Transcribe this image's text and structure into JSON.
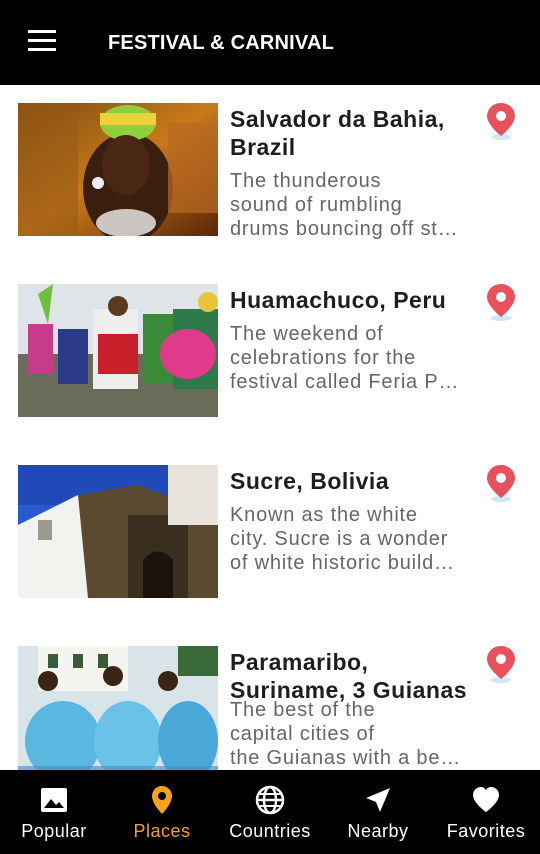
{
  "app": {
    "title": "FESTIVAL & CARNIVAL"
  },
  "colors": {
    "accent": "#f7a21b",
    "pin": "#e8505b",
    "bar": "#000000"
  },
  "places": [
    {
      "name": "Salvador da Bahia, Brazil",
      "desc": [
        "The thunderous",
        "sound of rumbling",
        "drums bouncing off st…"
      ],
      "icon": "map-pin-icon"
    },
    {
      "name": "Huamachuco, Peru",
      "desc": [
        "The weekend of",
        "celebrations for the",
        "festival called Feria P…"
      ],
      "icon": "map-pin-icon"
    },
    {
      "name": "Sucre, Bolivia",
      "desc": [
        "Known as the white",
        "city. Sucre is a wonder",
        "of white historic build…"
      ],
      "icon": "map-pin-icon"
    },
    {
      "name": "Paramaribo, Suriname, 3 Guianas",
      "desc": [
        "The best of the",
        "capital cities of",
        "the Guianas with a be…"
      ],
      "icon": "map-pin-icon"
    }
  ],
  "nav": [
    {
      "label": "Popular",
      "icon": "image-icon"
    },
    {
      "label": "Places",
      "icon": "location-pin-icon",
      "active": true
    },
    {
      "label": "Countries",
      "icon": "globe-icon"
    },
    {
      "label": "Nearby",
      "icon": "navigation-arrow-icon"
    },
    {
      "label": "Favorites",
      "icon": "heart-icon"
    }
  ]
}
